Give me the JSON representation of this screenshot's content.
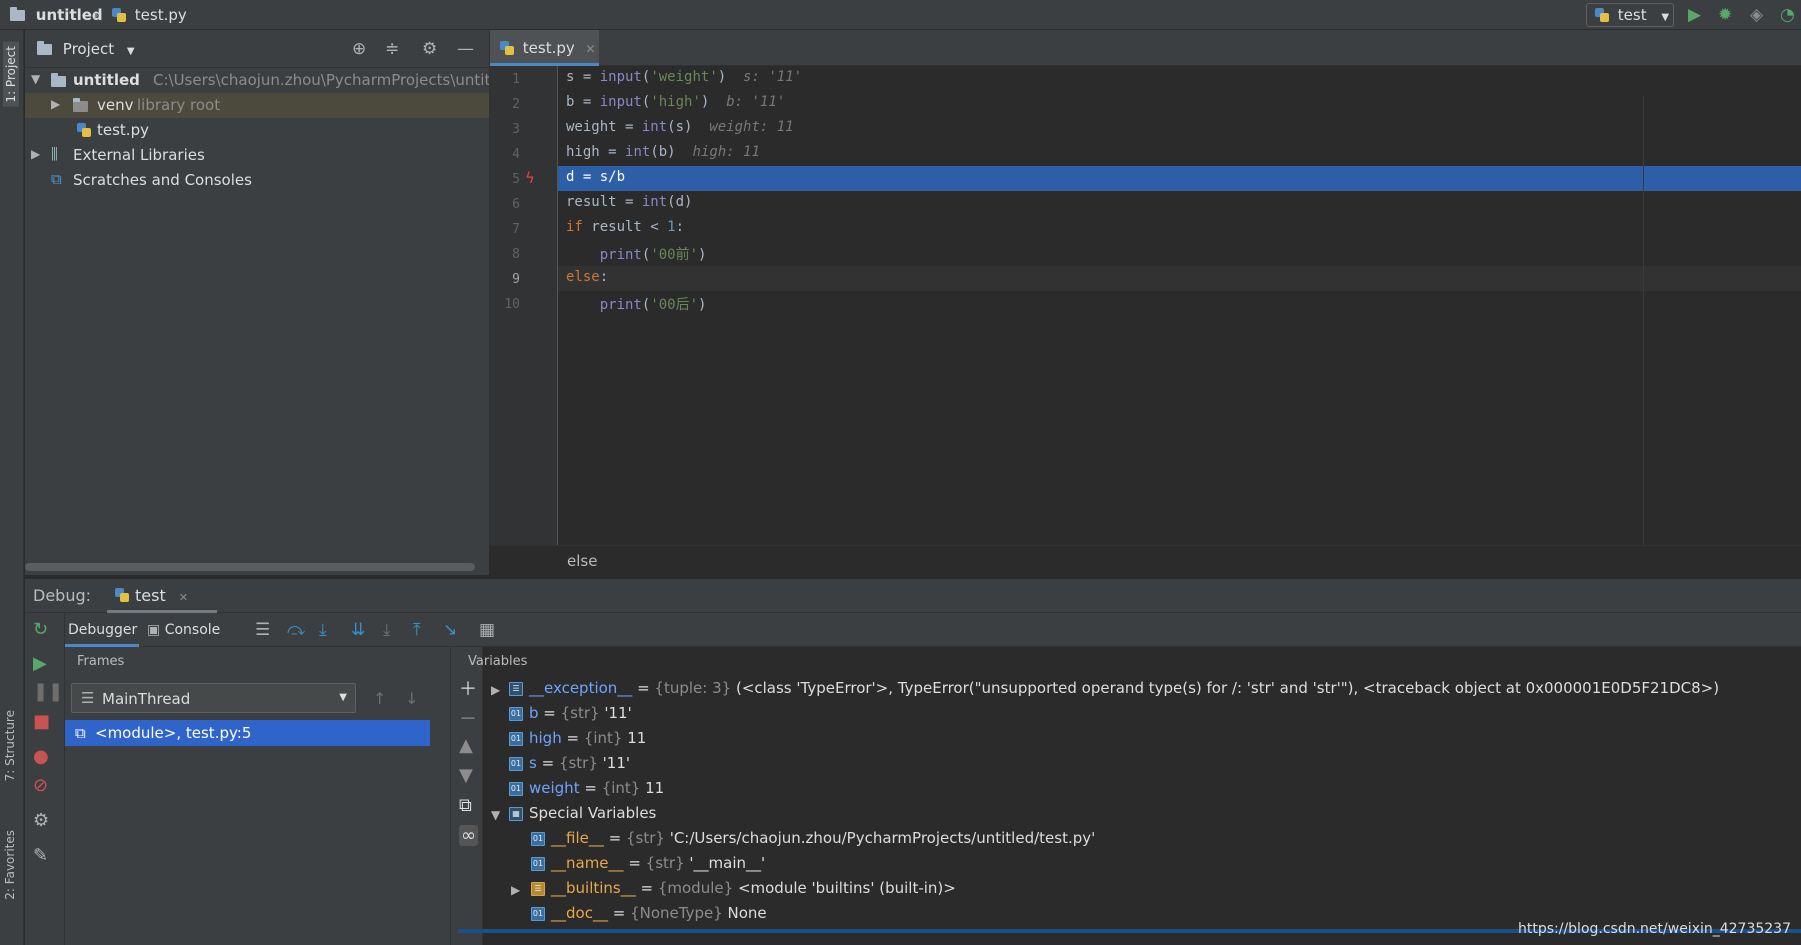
{
  "titlebar": {
    "project": "untitled",
    "file": "test.py",
    "run_config": "test"
  },
  "toolstrip": {
    "project_tab": "1: Project",
    "structure_tab": "7: Structure",
    "favorites_tab": "2: Favorites"
  },
  "project": {
    "title": "Project",
    "root": {
      "name": "untitled",
      "path": "C:\\Users\\chaojun.zhou\\PycharmProjects\\untitled"
    },
    "venv": {
      "name": "venv",
      "note": "library root"
    },
    "file": "test.py",
    "external": "External Libraries",
    "scratches": "Scratches and Consoles"
  },
  "editor": {
    "tab": "test.py",
    "breadcrumb": "else",
    "lines": [
      {
        "n": "1",
        "hint": "s: '11'"
      },
      {
        "n": "2",
        "hint": "b: '11'"
      },
      {
        "n": "3",
        "hint": "weight: 11"
      },
      {
        "n": "4",
        "hint": "high: 11"
      },
      {
        "n": "5"
      },
      {
        "n": "6"
      },
      {
        "n": "7"
      },
      {
        "n": "8"
      },
      {
        "n": "9"
      },
      {
        "n": "10"
      }
    ],
    "code": {
      "l1_var": "s = ",
      "l1_fn": "input",
      "l1_open": "(",
      "l1_str": "'weight'",
      "l1_close": ")",
      "l2_var": "b = ",
      "l2_fn": "input",
      "l2_open": "(",
      "l2_str": "'high'",
      "l2_close": ")",
      "l3_var": "weight = ",
      "l3_fn": "int",
      "l3_rest": "(s)",
      "l4_var": "high = ",
      "l4_fn": "int",
      "l4_rest": "(b)",
      "l5": "d = s/b",
      "l6_var": "result = ",
      "l6_fn": "int",
      "l6_rest": "(d)",
      "l7_kw": "if",
      "l7_rest": " result < ",
      "l7_num": "1",
      "l7_end": ":",
      "l8_indent": "    ",
      "l8_fn": "print",
      "l8_open": "(",
      "l8_str": "'00前'",
      "l8_close": ")",
      "l9_kw": "else",
      "l9_end": ":",
      "l10_indent": "    ",
      "l10_fn": "print",
      "l10_open": "(",
      "l10_str": "'00后'",
      "l10_close": ")"
    }
  },
  "debug": {
    "label": "Debug:",
    "session_tab": "test",
    "subtabs": {
      "debugger": "Debugger",
      "console": "Console"
    },
    "frames_title": "Frames",
    "thread": "MainThread",
    "frame": "<module>, test.py:5",
    "variables_title": "Variables",
    "variables": [
      {
        "name": "__exception__",
        "type": "{tuple: 3}",
        "value": "(<class 'TypeError'>, TypeError(\"unsupported operand type(s) for /: 'str' and 'str'\"), <traceback object at 0x000001E0D5F21DC8>)"
      },
      {
        "name": "b",
        "type": "{str}",
        "value": "'11'"
      },
      {
        "name": "high",
        "type": "{int}",
        "value": "11"
      },
      {
        "name": "s",
        "type": "{str}",
        "value": "'11'"
      },
      {
        "name": "weight",
        "type": "{int}",
        "value": "11"
      }
    ],
    "special_title": "Special Variables",
    "special": [
      {
        "name": "__file__",
        "type": "{str}",
        "value": "'C:/Users/chaojun.zhou/PycharmProjects/untitled/test.py'"
      },
      {
        "name": "__name__",
        "type": "{str}",
        "value": "'__main__'"
      },
      {
        "name": "__builtins__",
        "type": "{module}",
        "value": "<module 'builtins' (built-in)>"
      },
      {
        "name": "__doc__",
        "type": "{NoneType}",
        "value": "None"
      }
    ],
    "icon_label": "01",
    "equals": " = "
  },
  "watermark": "https://blog.csdn.net/weixin_42735237",
  "colors": {
    "background": "#2b2b2b",
    "panel": "#3c3f41",
    "selection": "#2d5fa8",
    "keyword": "#cc7832",
    "string": "#6a8759",
    "number": "#6897bb",
    "builtin": "#8888c6"
  }
}
